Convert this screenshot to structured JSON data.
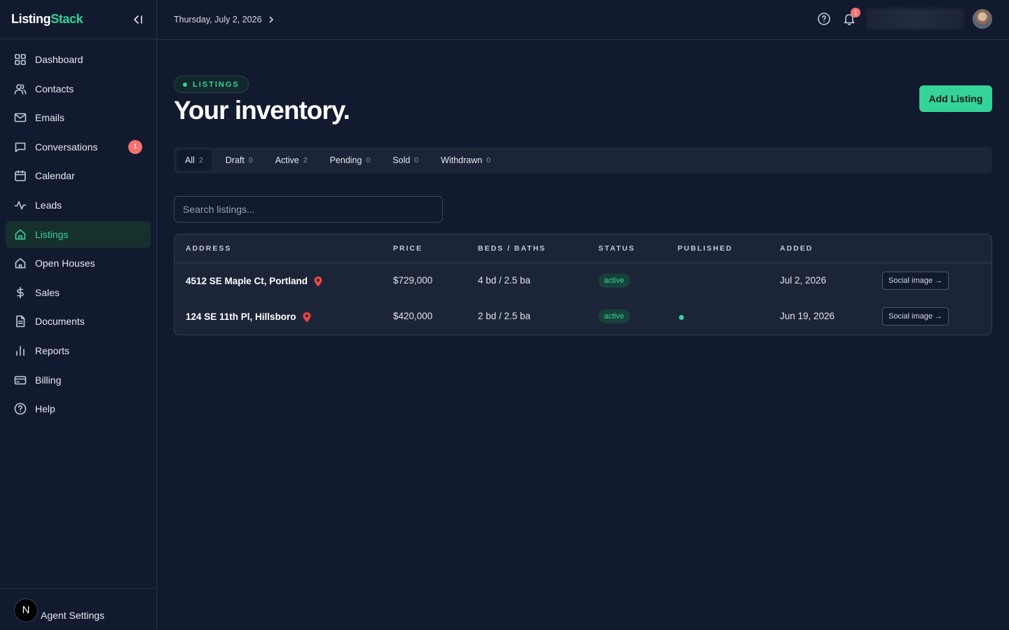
{
  "app": {
    "brand_main": "Listing",
    "brand_accent": "Stack",
    "accent_color": "#34d399"
  },
  "sidebar": {
    "items": [
      {
        "label": "Dashboard",
        "icon": "grid-icon"
      },
      {
        "label": "Contacts",
        "icon": "users-icon"
      },
      {
        "label": "Emails",
        "icon": "mail-icon"
      },
      {
        "label": "Conversations",
        "icon": "message-icon",
        "badge": "1"
      },
      {
        "label": "Calendar",
        "icon": "calendar-icon"
      },
      {
        "label": "Leads",
        "icon": "activity-icon"
      },
      {
        "label": "Listings",
        "icon": "home-icon",
        "active": true
      },
      {
        "label": "Open Houses",
        "icon": "house-icon"
      },
      {
        "label": "Sales",
        "icon": "dollar-icon"
      },
      {
        "label": "Documents",
        "icon": "document-icon"
      },
      {
        "label": "Reports",
        "icon": "bar-chart-icon"
      },
      {
        "label": "Billing",
        "icon": "credit-card-icon"
      },
      {
        "label": "Help",
        "icon": "help-circle-icon"
      }
    ],
    "footer": {
      "avatar_letter": "N",
      "label": "Agent Settings"
    }
  },
  "topbar": {
    "date": "Thursday, July 2, 2026",
    "notification_count": "1"
  },
  "header": {
    "tag": "LISTINGS",
    "title": "Your inventory.",
    "add_button": "Add Listing"
  },
  "tabs": [
    {
      "label": "All",
      "count": "2",
      "active": true
    },
    {
      "label": "Draft",
      "count": "0"
    },
    {
      "label": "Active",
      "count": "2"
    },
    {
      "label": "Pending",
      "count": "0"
    },
    {
      "label": "Sold",
      "count": "0"
    },
    {
      "label": "Withdrawn",
      "count": "0"
    }
  ],
  "search": {
    "placeholder": "Search listings..."
  },
  "table": {
    "columns": [
      "ADDRESS",
      "PRICE",
      "BEDS / BATHS",
      "STATUS",
      "PUBLISHED",
      "ADDED"
    ],
    "rows": [
      {
        "address": "4512 SE Maple Ct, Portland",
        "price": "$729,000",
        "beds_baths": "4 bd / 2.5 ba",
        "status": "active",
        "published": false,
        "added": "Jul 2, 2026",
        "action": "Social image →"
      },
      {
        "address": "124 SE 11th Pl, Hillsboro",
        "price": "$420,000",
        "beds_baths": "2 bd / 2.5 ba",
        "status": "active",
        "published": true,
        "added": "Jun 19, 2026",
        "action": "Social image →"
      }
    ]
  }
}
